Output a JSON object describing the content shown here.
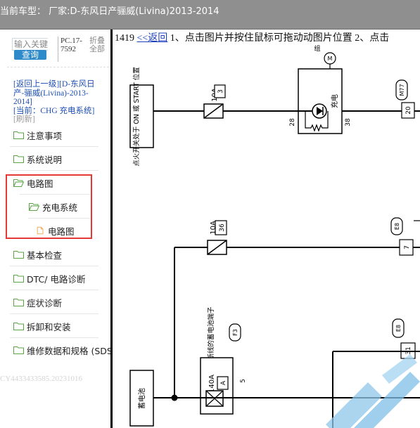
{
  "window": {
    "title": "当前车型：   厂家:D-东风日产骊威(Livina)2013-2014"
  },
  "sidebar": {
    "search": {
      "placeholder": "输入关键"
    },
    "query_label": "查询",
    "pc": {
      "line1": "PC.17-",
      "line2": "7592"
    },
    "fold": {
      "line1": "折叠",
      "line2": "全部"
    },
    "breadcrumb": {
      "back": "[返回上一级]",
      "back_target": "[D-东风日产-骊威(Livina)-2013-2014]",
      "current_prefix": "[当前：",
      "current": "CHG 充电系统",
      "current_suffix": "]",
      "refresh": "[刷新]"
    },
    "items": [
      {
        "label": "注意事项",
        "icon": "folder-icon"
      },
      {
        "label": "系统说明",
        "icon": "folder-icon"
      },
      {
        "label": "电路图",
        "icon": "folder-open-icon"
      },
      {
        "label": "充电系统",
        "icon": "folder-open-icon"
      },
      {
        "label": "电路图",
        "icon": "document-icon"
      },
      {
        "label": "基本检查",
        "icon": "folder-icon"
      },
      {
        "label": "DTC/ 电路诊断",
        "icon": "folder-icon"
      },
      {
        "label": "症状诊断",
        "icon": "folder-icon"
      },
      {
        "label": "拆卸和安装",
        "icon": "folder-icon"
      },
      {
        "label": "维修数据和规格 (SDS",
        "icon": "folder-icon"
      }
    ],
    "watermark": "CY4433433585.20231016"
  },
  "main": {
    "page_number": "1419",
    "back_label": "<<返回",
    "instructions": "1、点击图片并按住鼠标可拖动动图片位置 2、点击",
    "diagram": {
      "ignition_label": "点火开关处于 ON 或 START 位置",
      "fuse1_amp": "10A",
      "fuse1_no": "3",
      "fuse2_amp": "10A",
      "fuse2_no": "36",
      "fusible_amp": "140A",
      "fusible_no": "A",
      "charge_label": "充电",
      "pin28": "28",
      "pin38": "38",
      "pin5": "5",
      "m77": "M77",
      "m_top": "M",
      "c20": "20",
      "c7": "7",
      "c31": "31",
      "e8a": "E8",
      "e8b": "E8",
      "fusible_block_label": "带熔断线的蓄电池端子",
      "f3": "F3",
      "battery_label": "蓄电池",
      "top_partial": "组"
    }
  },
  "colors": {
    "titlebar": "#8f8f8f",
    "highlight_box": "#e53935",
    "link": "#1e4fb4",
    "query_button": "#2e8ac8"
  }
}
